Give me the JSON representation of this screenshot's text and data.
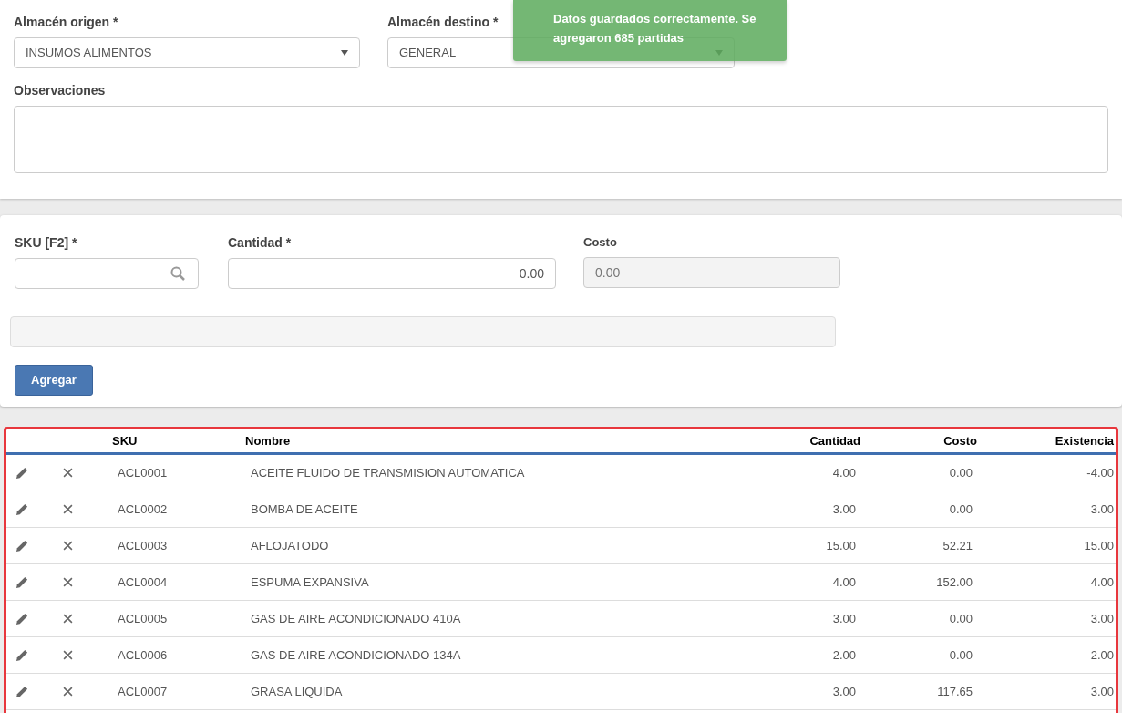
{
  "form": {
    "origin": {
      "label": "Almacén origen *",
      "value": "INSUMOS ALIMENTOS"
    },
    "destination": {
      "label": "Almacén destino *",
      "value": "GENERAL"
    },
    "notes": {
      "label": "Observaciones"
    }
  },
  "toast": {
    "message": "Datos guardados correctamente. Se agregaron 685 partidas"
  },
  "entry": {
    "sku": {
      "label": "SKU [F2] *"
    },
    "quantity": {
      "label": "Cantidad *",
      "value": "0.00"
    },
    "cost": {
      "label": "Costo",
      "value": "0.00",
      "disabled": true
    },
    "add_button": "Agregar"
  },
  "table": {
    "columns": [
      "SKU",
      "Nombre",
      "Cantidad",
      "Costo",
      "Existencia"
    ],
    "rows": [
      {
        "sku": "ACL0001",
        "name": "ACEITE FLUIDO DE TRANSMISION AUTOMATICA",
        "quantity": "4.00",
        "cost": "0.00",
        "stock": "-4.00"
      },
      {
        "sku": "ACL0002",
        "name": "BOMBA DE ACEITE",
        "quantity": "3.00",
        "cost": "0.00",
        "stock": "3.00"
      },
      {
        "sku": "ACL0003",
        "name": "AFLOJATODO",
        "quantity": "15.00",
        "cost": "52.21",
        "stock": "15.00"
      },
      {
        "sku": "ACL0004",
        "name": "ESPUMA EXPANSIVA",
        "quantity": "4.00",
        "cost": "152.00",
        "stock": "4.00"
      },
      {
        "sku": "ACL0005",
        "name": "GAS DE AIRE ACONDICIONADO 410A",
        "quantity": "3.00",
        "cost": "0.00",
        "stock": "3.00"
      },
      {
        "sku": "ACL0006",
        "name": "GAS DE AIRE ACONDICIONADO 134A",
        "quantity": "2.00",
        "cost": "0.00",
        "stock": "2.00"
      },
      {
        "sku": "ACL0007",
        "name": "GRASA LIQUIDA",
        "quantity": "3.00",
        "cost": "117.65",
        "stock": "3.00"
      }
    ]
  }
}
